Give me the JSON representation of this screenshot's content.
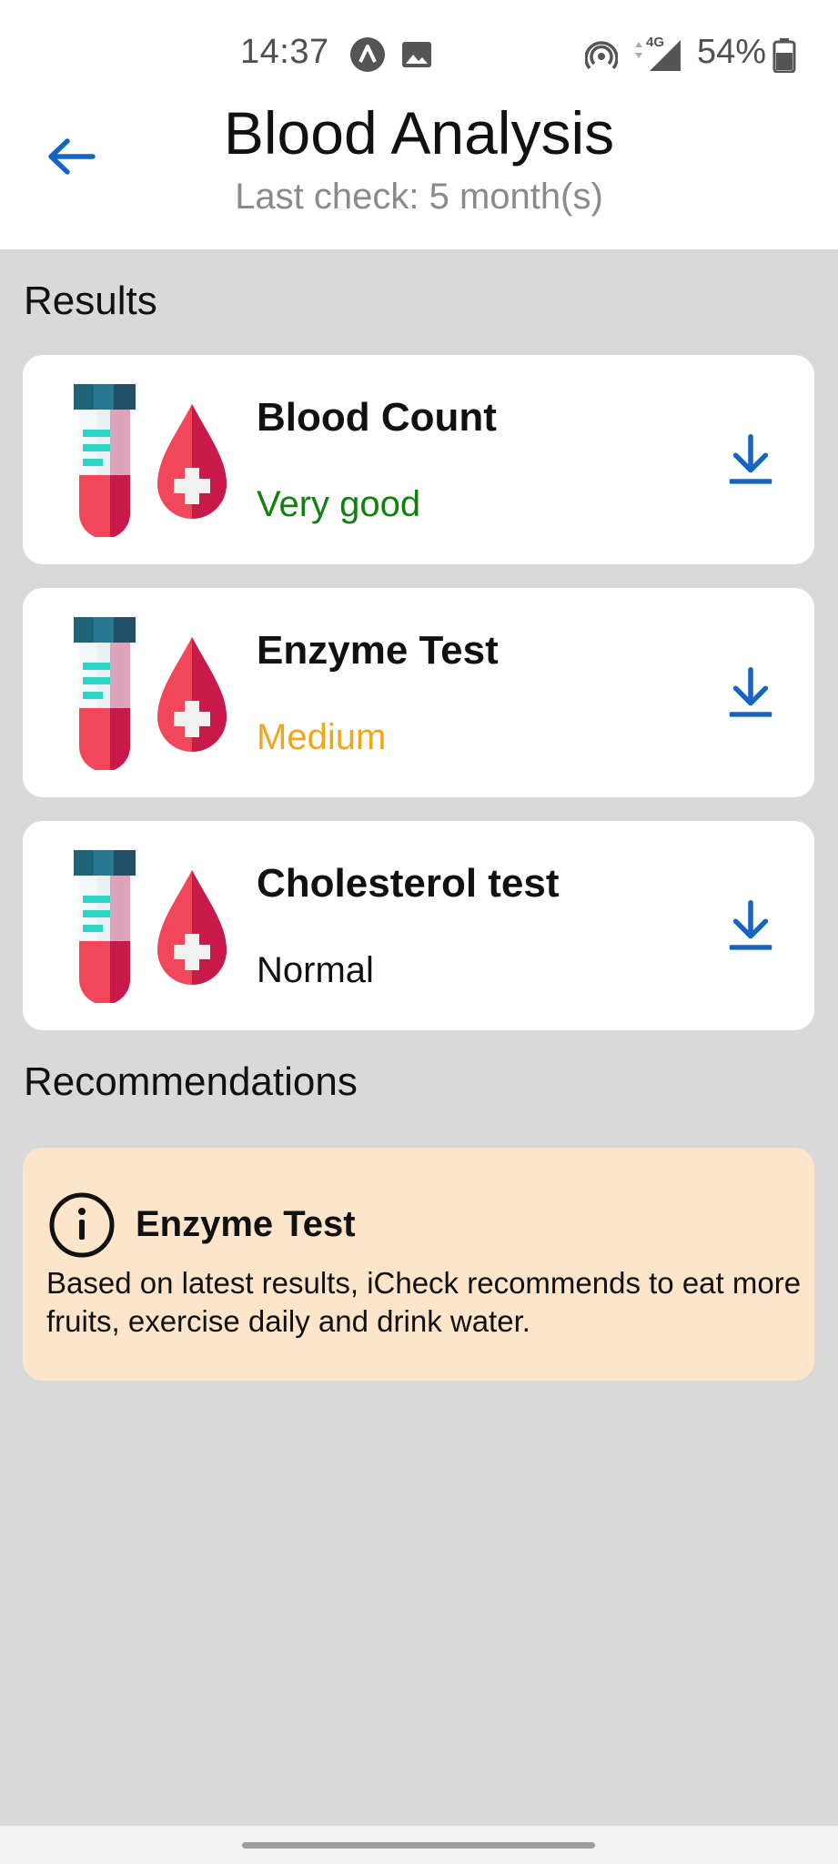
{
  "status_bar": {
    "time": "14:37",
    "network": "4G",
    "battery": "54%",
    "icons": [
      "a-notification-icon",
      "image-notification-icon",
      "hotspot-icon",
      "signal-icon",
      "battery-icon"
    ]
  },
  "header": {
    "title": "Blood Analysis",
    "subtitle": "Last check: 5 month(s)",
    "back_icon": "arrow-left-icon"
  },
  "results": {
    "heading": "Results",
    "items": [
      {
        "title": "Blood Count",
        "status": "Very good",
        "status_color": "#118011",
        "icon": "test-tube-blood-drop-icon",
        "action_icon": "download-icon"
      },
      {
        "title": "Enzyme Test",
        "status": "Medium",
        "status_color": "#f0a61c",
        "icon": "test-tube-blood-drop-icon",
        "action_icon": "download-icon"
      },
      {
        "title": "Cholesterol test",
        "status": "Normal",
        "status_color": "#111111",
        "icon": "test-tube-blood-drop-icon",
        "action_icon": "download-icon"
      }
    ]
  },
  "recommendations": {
    "heading": "Recommendations",
    "items": [
      {
        "title": "Enzyme Test",
        "body": "Based on latest results, iCheck recommends to eat more fruits, exercise daily and drink water.",
        "icon": "info-icon"
      }
    ]
  },
  "colors": {
    "accent": "#1565c0",
    "background": "#d9d9d9",
    "card": "#ffffff",
    "recommendation_bg": "#fde5cc"
  }
}
